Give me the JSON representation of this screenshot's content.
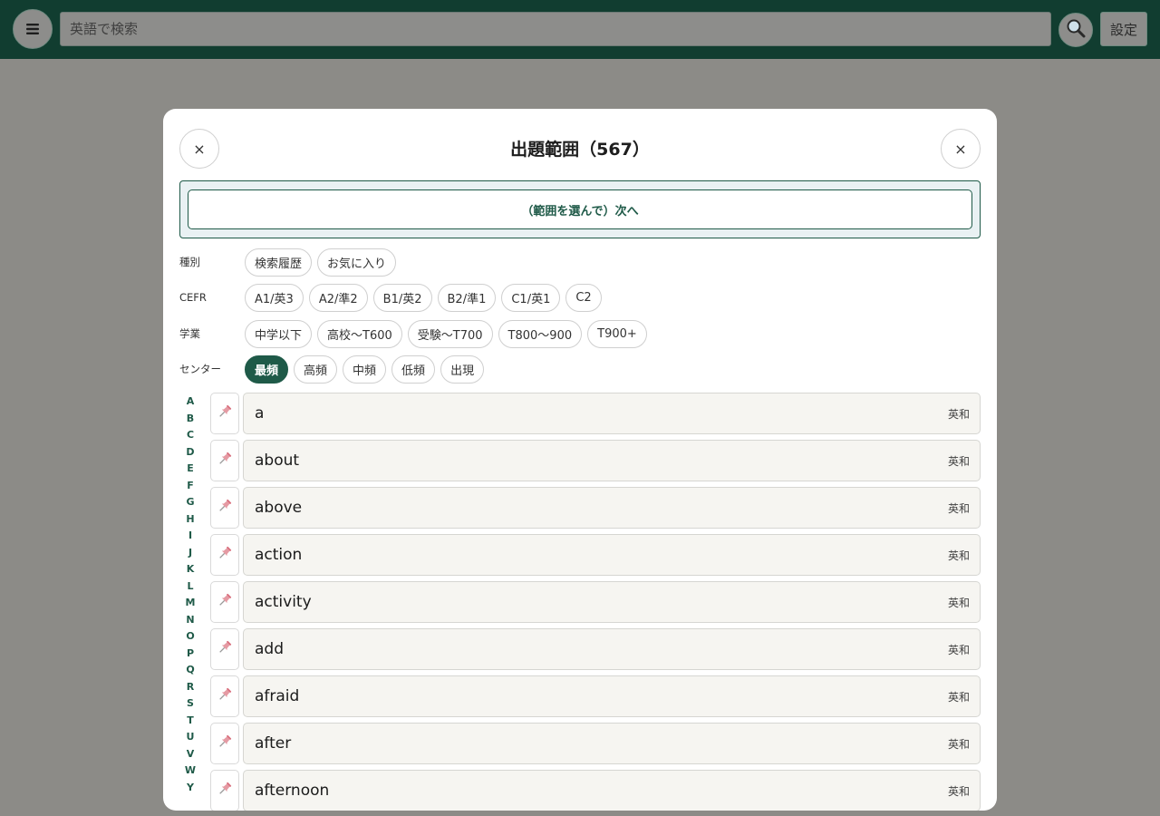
{
  "topbar": {
    "search_placeholder": "英語で検索",
    "settings_label": "設定",
    "menu_icon": "hamburger-icon",
    "search_icon": "magnifier-icon"
  },
  "modal": {
    "title": "出題範囲（567）",
    "close_left": "×",
    "close_right": "×",
    "next_label": "（範囲を選んで）次へ"
  },
  "filters": [
    {
      "label": "種別",
      "chips": [
        "検索履歴",
        "お気に入り"
      ],
      "active": -1
    },
    {
      "label": "CEFR",
      "chips": [
        "A1/英3",
        "A2/準2",
        "B1/英2",
        "B2/準1",
        "C1/英1",
        "C2"
      ],
      "active": -1
    },
    {
      "label": "学業",
      "chips": [
        "中学以下",
        "高校〜T600",
        "受験〜T700",
        "T800〜900",
        "T900+"
      ],
      "active": -1
    },
    {
      "label": "センター",
      "chips": [
        "最頻",
        "高頻",
        "中頻",
        "低頻",
        "出現"
      ],
      "active": 0
    }
  ],
  "alphabet": [
    "A",
    "B",
    "C",
    "D",
    "E",
    "F",
    "G",
    "H",
    "I",
    "J",
    "K",
    "L",
    "M",
    "N",
    "O",
    "P",
    "Q",
    "R",
    "S",
    "T",
    "U",
    "V",
    "W",
    "Y"
  ],
  "words": [
    {
      "word": "a",
      "tag": "英和"
    },
    {
      "word": "about",
      "tag": "英和"
    },
    {
      "word": "above",
      "tag": "英和"
    },
    {
      "word": "action",
      "tag": "英和"
    },
    {
      "word": "activity",
      "tag": "英和"
    },
    {
      "word": "add",
      "tag": "英和"
    },
    {
      "word": "afraid",
      "tag": "英和"
    },
    {
      "word": "after",
      "tag": "英和"
    },
    {
      "word": "afternoon",
      "tag": "英和"
    }
  ],
  "colors": {
    "brand": "#113d30",
    "accent": "#1f5a48",
    "pin": "#e08a94"
  }
}
